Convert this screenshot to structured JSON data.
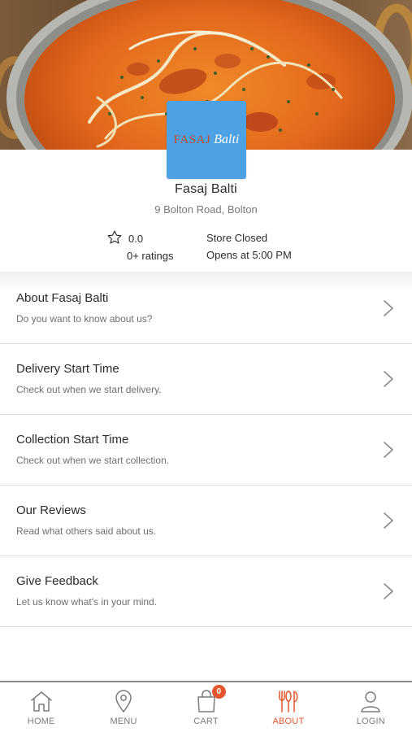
{
  "store": {
    "logo_word1": "FASAJ",
    "logo_word2": "Balti",
    "name": "Fasaj Balti",
    "address": "9 Bolton Road, Bolton",
    "rating_value": "0.0",
    "rating_count": "0+ ratings",
    "status": "Store Closed",
    "opens_at": "Opens at 5:00 PM",
    "hero_image": "curry-dish-photo",
    "logo_color": "#4ea1e3"
  },
  "list": [
    {
      "title": "About Fasaj Balti",
      "subtitle": "Do you want to know about us?"
    },
    {
      "title": "Delivery Start Time",
      "subtitle": "Check out when we start delivery."
    },
    {
      "title": "Collection Start Time",
      "subtitle": "Check out when we start collection."
    },
    {
      "title": "Our Reviews",
      "subtitle": "Read what others said about us."
    },
    {
      "title": "Give Feedback",
      "subtitle": "Let us know what's in your mind."
    }
  ],
  "nav": {
    "home": "HOME",
    "menu": "MENU",
    "cart": "CART",
    "cart_count": "0",
    "about": "ABOUT",
    "login": "LOGIN",
    "active": "about",
    "accent_color": "#e4572e"
  },
  "icons": {
    "star": "star-outline-icon",
    "chevron": "chevron-right-icon",
    "home": "home-icon",
    "menu": "map-pin-icon",
    "cart": "shopping-bag-icon",
    "about": "fork-knife-icon",
    "login": "user-icon"
  }
}
